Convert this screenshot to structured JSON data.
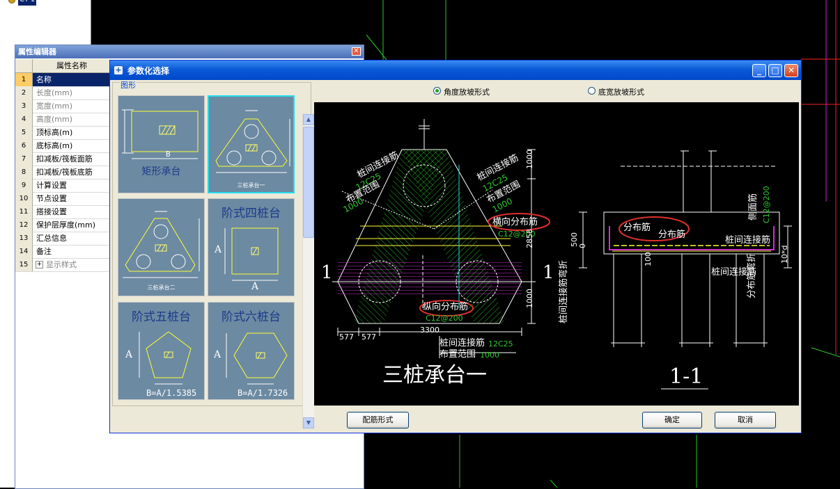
{
  "tree": {
    "node_label": "CT-1"
  },
  "property_editor": {
    "title": "属性编辑器",
    "column_header": "属性名称",
    "rows": [
      {
        "idx": "1",
        "name": "名称"
      },
      {
        "idx": "2",
        "name": "长度(mm)"
      },
      {
        "idx": "3",
        "name": "宽度(mm)"
      },
      {
        "idx": "4",
        "name": "高度(mm)"
      },
      {
        "idx": "5",
        "name": "顶标高(m)"
      },
      {
        "idx": "6",
        "name": "底标高(m)"
      },
      {
        "idx": "7",
        "name": "扣减板/筏板面筋"
      },
      {
        "idx": "8",
        "name": "扣减板/筏板底筋"
      },
      {
        "idx": "9",
        "name": "计算设置"
      },
      {
        "idx": "10",
        "name": "节点设置"
      },
      {
        "idx": "11",
        "name": "搭接设置"
      },
      {
        "idx": "12",
        "name": "保护层厚度(mm)"
      },
      {
        "idx": "13",
        "name": "汇总信息"
      },
      {
        "idx": "14",
        "name": "备注"
      },
      {
        "idx": "15",
        "name": "显示样式",
        "expander": "+"
      }
    ]
  },
  "dialog": {
    "title": "参数化选择",
    "group_label": "图形",
    "tiles": [
      {
        "caption": "矩形承台",
        "dim": "B"
      },
      {
        "caption": "三桩承台一"
      },
      {
        "caption": "三桩承台二"
      },
      {
        "caption": "阶式四桩台",
        "dim_a": "A",
        "dim_b": "A"
      },
      {
        "caption": "阶式五桩台",
        "dim_a": "A",
        "formula": "B=A/1.5385"
      },
      {
        "caption": "阶式六桩台",
        "dim_a": "A",
        "formula": "B=A/1.7326"
      }
    ],
    "radio_options": [
      {
        "label": "角度放坡形式",
        "checked": true
      },
      {
        "label": "底宽放坡形式",
        "checked": false
      }
    ],
    "buttons": {
      "rebar_form": "配筋形式",
      "ok": "确定",
      "cancel": "取消"
    }
  },
  "drawing": {
    "plan_title": "三桩承台一",
    "section_title": "1-1",
    "section_mark": "1",
    "labels": {
      "pile_tie_left": "桩间连接筋",
      "pile_tie_left_spec": "12C25",
      "range_left": "布置范围",
      "range_left_val": "1000",
      "pile_tie_right": "桩间连接筋",
      "pile_tie_right_spec": "12C25",
      "range_right": "布置范围",
      "range_right_val": "1000",
      "transverse": "横向分布筋",
      "transverse_spec": "C12@200",
      "longitudinal": "纵向分布筋",
      "longitudinal_spec": "C12@200",
      "bottom_tie": "桩间连接筋",
      "bottom_tie_spec": "12C25",
      "bottom_range": "布置范围",
      "bottom_range_val": "1000",
      "dim_1000_top": "1000",
      "dim_2858": "2858",
      "dim_1000_bot": "1000",
      "dim_577a": "577",
      "dim_577b": "577",
      "dim_3300": "3300",
      "sec_dist1": "分布筋",
      "sec_dist2": "分布筋",
      "sec_side": "侧面筋",
      "sec_side_spec": "C12@200",
      "sec_tie": "桩间连接筋",
      "sec_tie2": "桩间连接筋",
      "sec_dim_500": "500",
      "sec_dim_0": "0",
      "sec_dim_100": "100",
      "sec_dim_10d": "10*d",
      "sec_left_vert": "桩间连接筋弯折",
      "sec_right_vert": "分布筋弯折"
    }
  }
}
